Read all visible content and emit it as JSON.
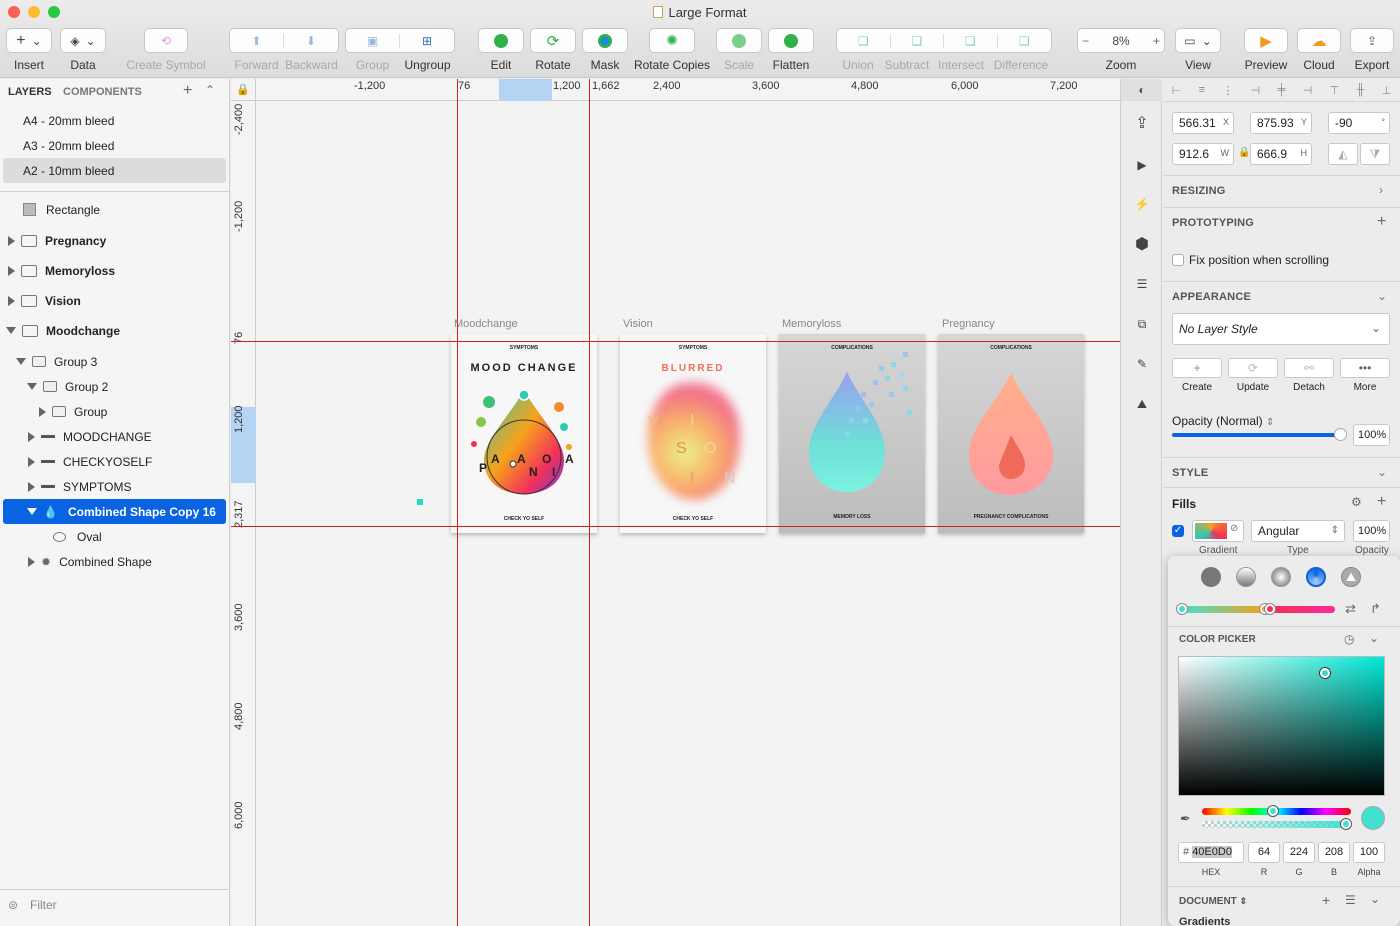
{
  "window": {
    "title": "Large Format"
  },
  "toolbar": {
    "insert": "Insert",
    "data": "Data",
    "create_symbol": "Create Symbol",
    "forward": "Forward",
    "backward": "Backward",
    "group": "Group",
    "ungroup": "Ungroup",
    "edit": "Edit",
    "rotate": "Rotate",
    "mask": "Mask",
    "rotate_copies": "Rotate Copies",
    "scale": "Scale",
    "flatten": "Flatten",
    "union": "Union",
    "subtract": "Subtract",
    "intersect": "Intersect",
    "difference": "Difference",
    "zoom": "Zoom",
    "zoom_value": "8%",
    "view": "View",
    "preview": "Preview",
    "cloud": "Cloud",
    "export": "Export",
    "zoom_minus": "−",
    "zoom_plus": "+",
    "insert_glyph": "+"
  },
  "layers_panel": {
    "tab_layers": "LAYERS",
    "tab_components": "COMPONENTS",
    "items": [
      {
        "label": "A4 - 20mm bleed"
      },
      {
        "label": "A3 - 20mm bleed"
      },
      {
        "label": "A2 - 10mm bleed"
      },
      {
        "label": "Rectangle"
      },
      {
        "label": "Pregnancy"
      },
      {
        "label": "Memoryloss"
      },
      {
        "label": "Vision"
      },
      {
        "label": "Moodchange"
      },
      {
        "label": "Group 3"
      },
      {
        "label": "Group 2"
      },
      {
        "label": "Group"
      },
      {
        "label": "MOODCHANGE"
      },
      {
        "label": "CHECKYOSELF"
      },
      {
        "label": "SYMPTOMS"
      },
      {
        "label": "Combined Shape Copy 16"
      },
      {
        "label": "Oval"
      },
      {
        "label": "Combined Shape"
      }
    ],
    "filter_placeholder": "Filter"
  },
  "rulers": {
    "top": [
      "-1,200",
      "76",
      "1,200",
      "1,662",
      "2,400",
      "3,600",
      "4,800",
      "6,000",
      "7,200"
    ],
    "left": [
      "-2,400",
      "-1,200",
      "76",
      "1,200",
      "2,317",
      "3,600",
      "4,800",
      "6,000"
    ]
  },
  "canvas": {
    "artboards": [
      {
        "name": "Moodchange",
        "header": "SYMPTOMS",
        "title": "MOOD CHANGE",
        "footer": "CHECK YO SELF",
        "letters": [
          "P",
          "A",
          "A",
          "O",
          "A",
          "N",
          "I"
        ]
      },
      {
        "name": "Vision",
        "header": "SYMPTOMS",
        "title": "BLURRED",
        "footer": "CHECK YO SELF",
        "letters": [
          "V",
          "I",
          "S",
          "O",
          "I",
          "N"
        ]
      },
      {
        "name": "Memoryloss",
        "header": "COMPLICATIONS",
        "title": "",
        "footer": "MEMORY LOSS"
      },
      {
        "name": "Pregnancy",
        "header": "COMPLICATIONS",
        "title": "",
        "footer": "PREGNANCY COMPLICATIONS"
      }
    ]
  },
  "inspector": {
    "x": "566.31",
    "x_label": "X",
    "y": "875.93",
    "y_label": "Y",
    "rotation": "-90",
    "rotation_unit": "°",
    "w": "912.6",
    "w_label": "W",
    "h": "666.9",
    "h_label": "H",
    "resizing": "RESIZING",
    "prototyping": "PROTOTYPING",
    "fix_position": "Fix position when scrolling",
    "appearance": "APPEARANCE",
    "layer_style": "No Layer Style",
    "style_actions": [
      "Create",
      "Update",
      "Detach",
      "More"
    ],
    "opacity_label": "Opacity (Normal)",
    "opacity_value": "100%",
    "opacity_fraction": 0.98,
    "style": "STYLE",
    "fills": "Fills",
    "fill_type": "Angular",
    "fill_opacity": "100%",
    "fill_col_gradient": "Gradient",
    "fill_col_type": "Type",
    "fill_col_opacity": "Opacity"
  },
  "color_picker": {
    "label": "COLOR PICKER",
    "hex_prefix": "#",
    "hex": "40E0D0",
    "r": "64",
    "g": "224",
    "b": "208",
    "alpha": "100",
    "hex_label": "HEX",
    "r_label": "R",
    "g_label": "G",
    "b_label": "B",
    "alpha_label": "Alpha",
    "document": "DOCUMENT",
    "gradients": "Gradients"
  },
  "colors": {
    "accent": "#0a63e0",
    "guide": "#cc2222",
    "turquoise": "#40e0d0"
  }
}
